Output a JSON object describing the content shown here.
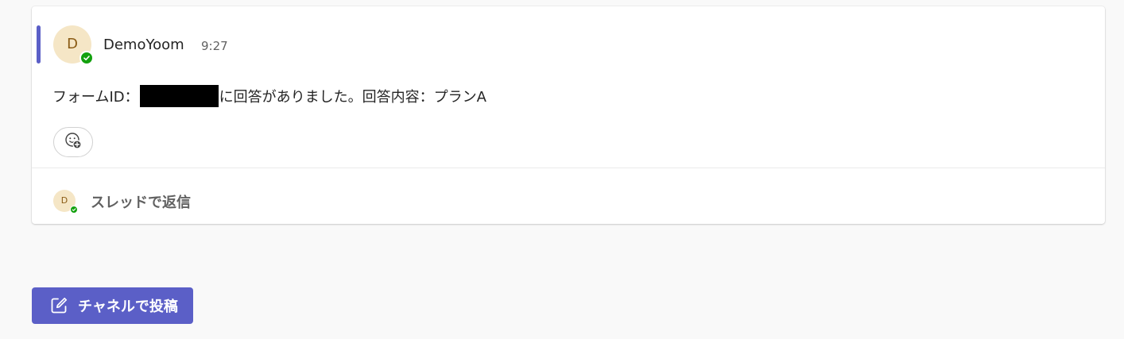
{
  "message": {
    "author": "DemoYoom",
    "author_initial": "D",
    "time": "9:27",
    "text_before": "フォームID：",
    "text_after": "に回答がありました。回答内容：プランA"
  },
  "reply": {
    "avatar_initial": "D",
    "label": "スレッドで返信"
  },
  "compose": {
    "post_label": "チャネルで投稿"
  },
  "colors": {
    "accent": "#5b5fc7",
    "presence": "#13a10e",
    "avatar_bg": "#f5e6c6"
  },
  "icons": {
    "reaction": "add-reaction-icon",
    "compose": "compose-icon",
    "presence": "presence-available-icon"
  }
}
